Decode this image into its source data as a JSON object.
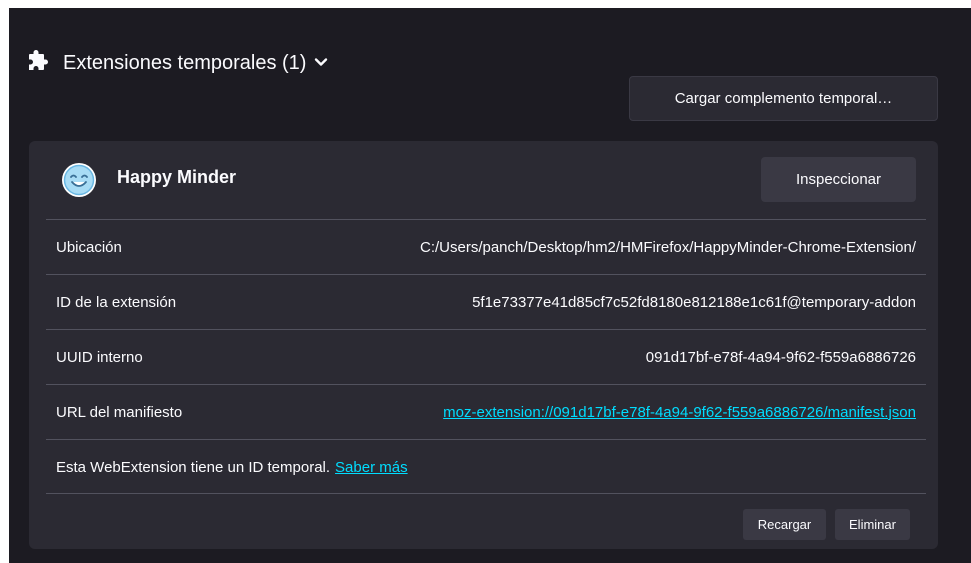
{
  "section": {
    "title": "Extensiones temporales (1)",
    "icon": "puzzle-icon",
    "toggle_icon": "chevron-down-icon",
    "load_button": "Cargar complemento temporal…"
  },
  "addon": {
    "name": "Happy Minder",
    "icon": "smiley-face-icon",
    "inspect_button": "Inspeccionar",
    "fields": [
      {
        "label": "Ubicación",
        "value": "C:/Users/panch/Desktop/hm2/HMFirefox/HappyMinder-Chrome-Extension/"
      },
      {
        "label": "ID de la extensión",
        "value": "5f1e73377e41d85cf7c52fd8180e812188e1c61f@temporary-addon"
      },
      {
        "label": "UUID interno",
        "value": "091d17bf-e78f-4a94-9f62-f559a6886726"
      },
      {
        "label": "URL del manifiesto",
        "value": "moz-extension://091d17bf-e78f-4a94-9f62-f559a6886726/manifest.json"
      }
    ],
    "note_text": "Esta WebExtension tiene un ID temporal.",
    "note_link": "Saber más",
    "reload_button": "Recargar",
    "remove_button": "Eliminar"
  },
  "colors": {
    "background": "#1c1b22",
    "card": "#2b2a33",
    "button": "#3a3944",
    "link": "#00ddff",
    "text": "#fbfbfe"
  }
}
